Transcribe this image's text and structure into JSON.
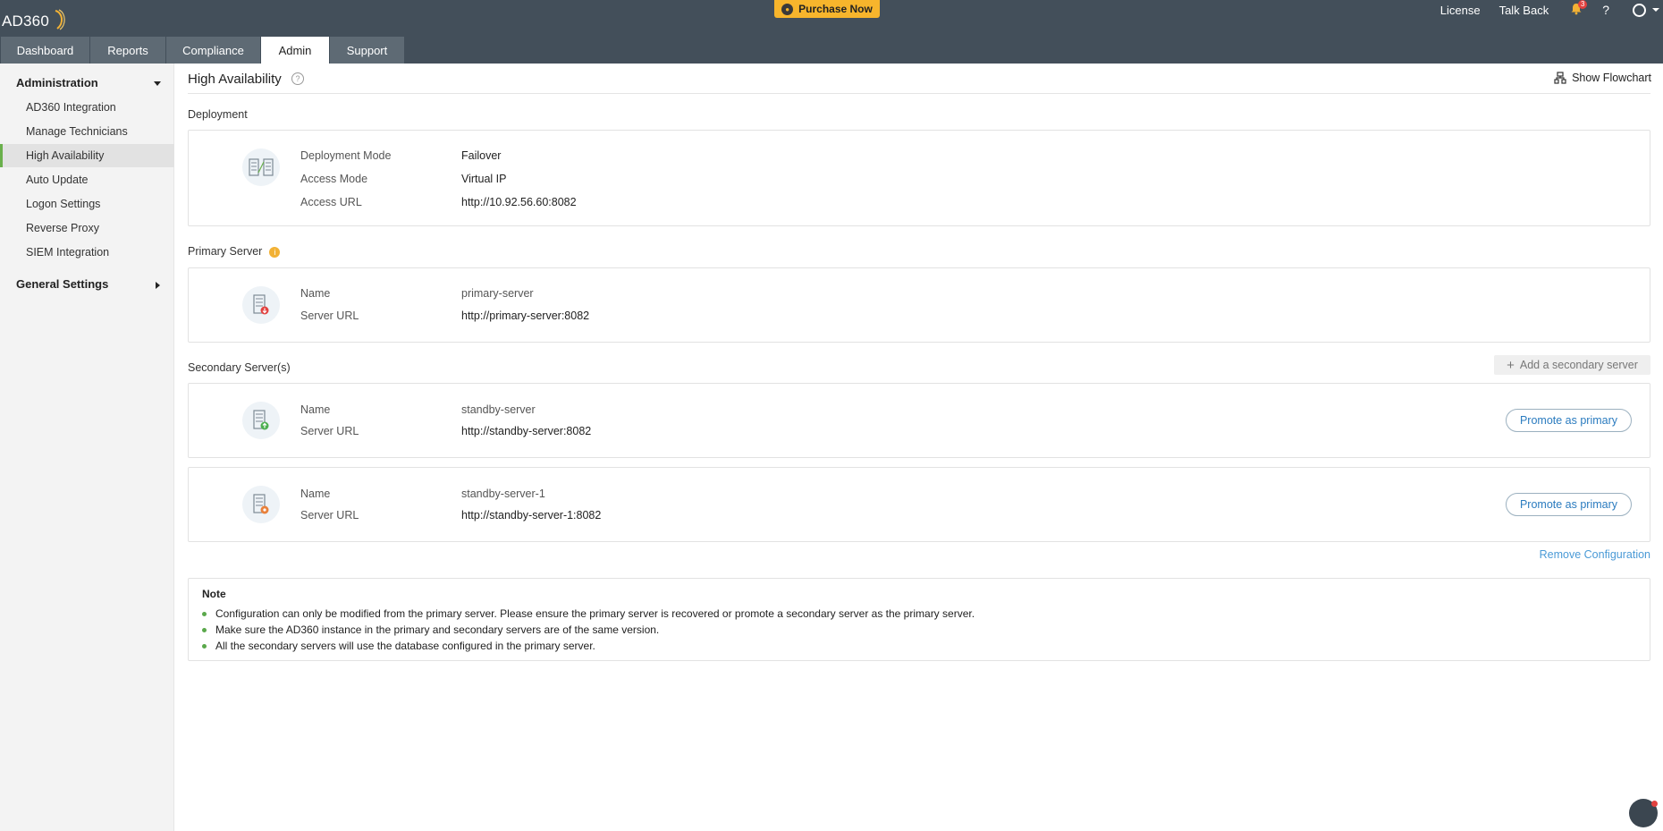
{
  "header": {
    "logo_text": "AD360",
    "purchase_label": "Purchase Now",
    "links": [
      "License",
      "Talk Back"
    ],
    "notification_count": "3",
    "help_label": "?"
  },
  "tabs": [
    {
      "label": "Dashboard"
    },
    {
      "label": "Reports"
    },
    {
      "label": "Compliance"
    },
    {
      "label": "Admin"
    },
    {
      "label": "Support"
    }
  ],
  "sidebar": {
    "section_title": "Administration",
    "items": [
      {
        "label": "AD360 Integration"
      },
      {
        "label": "Manage Technicians"
      },
      {
        "label": "High Availability"
      },
      {
        "label": "Auto Update"
      },
      {
        "label": "Logon Settings"
      },
      {
        "label": "Reverse Proxy"
      },
      {
        "label": "SIEM Integration"
      }
    ],
    "general_settings": "General Settings"
  },
  "page": {
    "title": "High Availability",
    "show_flowchart": "Show Flowchart",
    "deployment": {
      "section_label": "Deployment",
      "rows": [
        {
          "label": "Deployment Mode",
          "value": "Failover"
        },
        {
          "label": "Access Mode",
          "value": "Virtual IP"
        },
        {
          "label": "Access URL",
          "value": "http://10.92.56.60:8082"
        }
      ]
    },
    "primary": {
      "section_label": "Primary Server",
      "name_label": "Name",
      "name_value": "primary-server",
      "url_label": "Server URL",
      "url_value": "http://primary-server:8082"
    },
    "secondary": {
      "section_label": "Secondary Server(s)",
      "add_label": "Add a secondary server",
      "servers": [
        {
          "name_label": "Name",
          "name_value": "standby-server",
          "url_label": "Server URL",
          "url_value": "http://standby-server:8082",
          "action": "Promote as primary"
        },
        {
          "name_label": "Name",
          "name_value": "standby-server-1",
          "url_label": "Server URL",
          "url_value": "http://standby-server-1:8082",
          "action": "Promote as primary"
        }
      ]
    },
    "remove_config": "Remove Configuration",
    "note": {
      "title": "Note",
      "items": [
        "Configuration can only be modified from the primary server. Please ensure the primary server is recovered or promote a secondary server as the primary server.",
        "Make sure the AD360 instance in the primary and secondary servers are of the same version.",
        "All the secondary servers will use the database configured in the primary server."
      ]
    }
  },
  "colors": {
    "header_bg": "#434f5a",
    "tab_bg": "#5e6a74",
    "accent_yellow": "#f7b52c",
    "active_green": "#6ab04c",
    "link_blue": "#2a7bbf"
  }
}
